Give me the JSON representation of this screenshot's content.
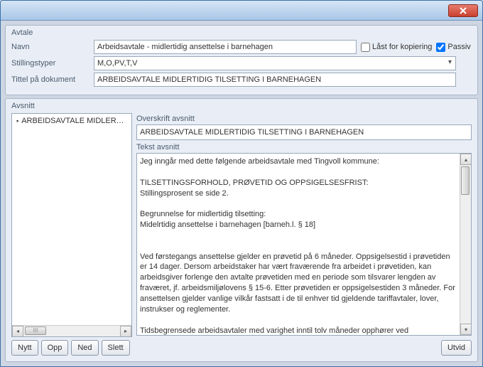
{
  "header": {
    "panel_title": "Avtale",
    "navn_label": "Navn",
    "navn_value": "Arbeidsavtale - midlertidig ansettelse i barnehagen",
    "last_label": "Låst for kopiering",
    "passiv_label": "Passiv",
    "stillingstyper_label": "Stillingstyper",
    "stillingstyper_value": "M,O,PV,T,V",
    "tittel_label": "Tittel på dokument",
    "tittel_value": "ARBEIDSAVTALE MIDLERTIDIG TILSETTING I BARNEHAGEN"
  },
  "avsnitt": {
    "panel_title": "Avsnitt",
    "list": [
      "ARBEIDSAVTALE MIDLERTI.."
    ],
    "buttons": {
      "nytt": "Nytt",
      "opp": "Opp",
      "ned": "Ned",
      "slett": "Slett"
    },
    "overskrift_label": "Overskrift avsnitt",
    "overskrift_value": "ARBEIDSAVTALE MIDLERTIDIG TILSETTING I BARNEHAGEN",
    "tekst_label": "Tekst avsnitt",
    "tekst_value": "Jeg inngår med dette følgende arbeidsavtale med Tingvoll kommune:\n\nTILSETTINGSFORHOLD, PRØVETID OG OPPSIGELSESFRIST:\nStillingsprosent se side 2.\n\nBegrunnelse for midlertidig tilsetting:\nMidelrtidig ansettelse i barnehagen [barneh.l. § 18]\n\n\nVed førstegangs ansettelse gjelder en prøvetid på 6 måneder. Oppsigelsestid i prøvetiden er 14 dager. Dersom arbeidstaker har vært fraværende fra arbeidet i prøvetiden, kan arbeidsgiver forlenge den avtalte prøvetiden med en periode som tilsvarer lengden av fraværet, jf. arbeidsmiljølovens § 15-6. Etter prøvetiden er oppsigelsestiden 3 måneder. For ansettelsen gjelder vanlige vilkår fastsatt i de til enhver tid gjeldende tariffavtaler, lover, instrukser og reglementer.\n\nTidsbegrensede arbeidsavtaler med varighet inntil tolv måneder opphører ved",
    "utvid": "Utvid"
  },
  "scroll_thumb_text": "III"
}
